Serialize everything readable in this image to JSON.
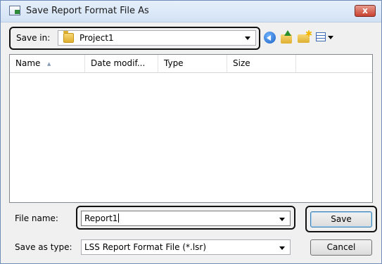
{
  "window": {
    "title": "Save Report Format File As",
    "close_glyph": "x"
  },
  "savein": {
    "label": "Save in:",
    "value": "Project1"
  },
  "toolbar": {
    "icons": [
      "back-icon",
      "up-folder-icon",
      "new-folder-icon",
      "view-menu-icon"
    ]
  },
  "filelist": {
    "columns": [
      "Name",
      "Date modif...",
      "Type",
      "Size"
    ],
    "items": []
  },
  "filename": {
    "label": "File name:",
    "value": "Report1"
  },
  "savetype": {
    "label": "Save as type:",
    "value": "LSS Report Format File (*.lsr)"
  },
  "buttons": {
    "save": "Save",
    "cancel": "Cancel"
  }
}
